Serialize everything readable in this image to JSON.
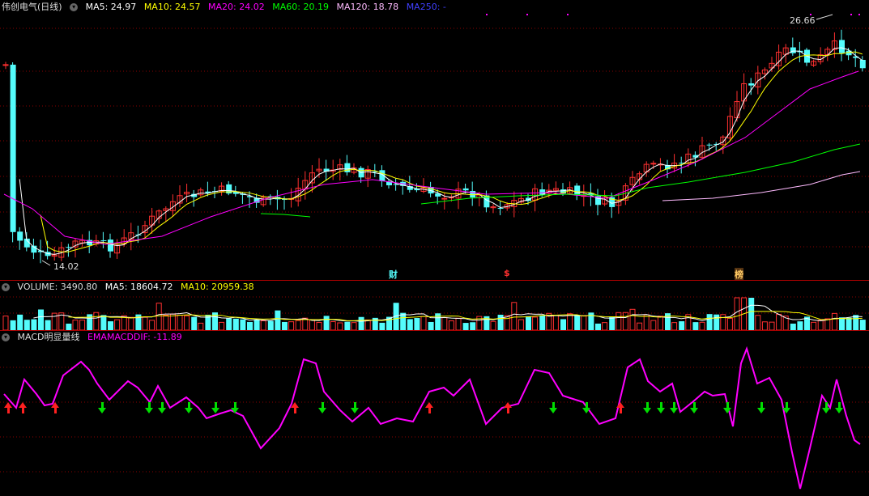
{
  "stock": {
    "name": "伟创电气(日线)",
    "ma5_label": "MA5: 24.97",
    "ma10_label": "MA10: 24.57",
    "ma20_label": "MA20: 24.02",
    "ma60_label": "MA60: 20.19",
    "ma120_label": "MA120: 18.78",
    "ma250_label": "MA250: -",
    "high_label": "26.66",
    "low_label": "14.02"
  },
  "markers": {
    "cai": "财",
    "dollar": "$",
    "bang": "榜"
  },
  "volume": {
    "label": "VOLUME: 3490.80",
    "ma5_label": "MA5: 18604.72",
    "ma10_label": "MA10: 20959.38"
  },
  "macd": {
    "title": "MACD明显量线",
    "dif_label": "EMAMACDDIF: -11.89"
  },
  "colors": {
    "up": "#ff3030",
    "down": "#54fcfc",
    "ma5": "#ffffff",
    "ma10": "#ffff00",
    "ma20": "#ff00ff",
    "ma60": "#00ff00",
    "ma120": "#ffbbff",
    "ma250": "#0000ff",
    "macd_line": "#ff00ff",
    "grid": "#8b0000"
  }
}
